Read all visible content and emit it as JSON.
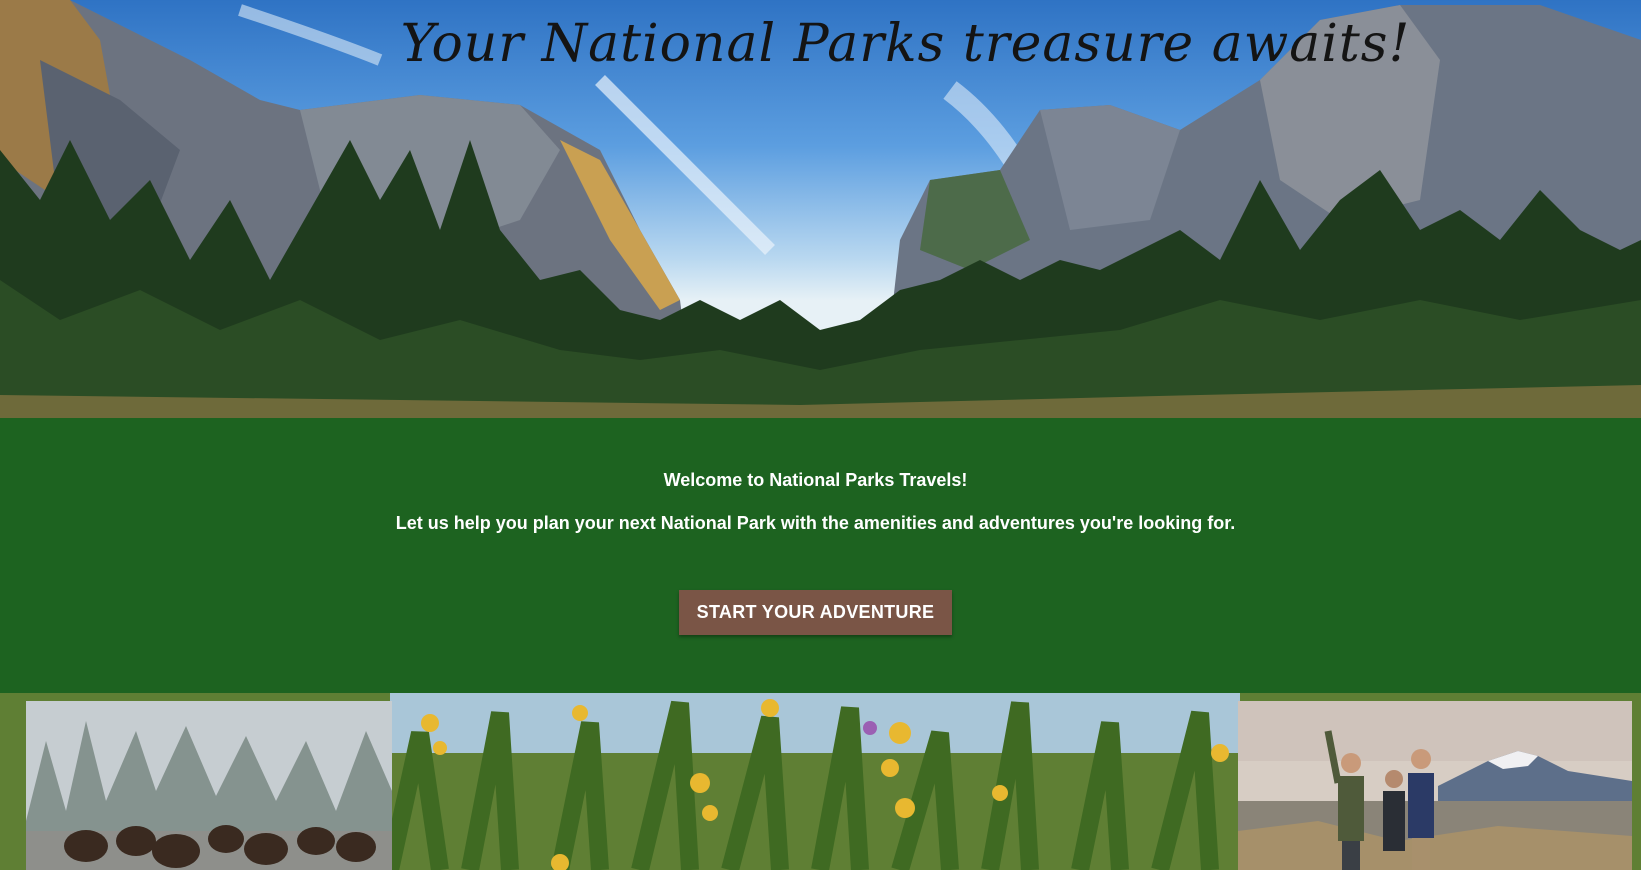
{
  "hero": {
    "title": "Your National Parks treasure awaits!",
    "image_subject": "Yosemite Valley with granite cliffs and pine forest"
  },
  "welcome": {
    "heading": "Welcome to National Parks Travels!",
    "text": "Let us help you plan your next National Park with the amenities and adventures you're looking for.",
    "button_label": "START YOUR ADVENTURE"
  },
  "gallery": {
    "background_subject": "wildflowers and tall grass",
    "photos": [
      {
        "subject": "bison herd walking on misty road"
      },
      {
        "subject": "group of hikers taking a selfie with mountains behind"
      }
    ]
  },
  "colors": {
    "band_green": "#1d6320",
    "button_brown": "#7a5546",
    "text_white": "#ffffff"
  }
}
